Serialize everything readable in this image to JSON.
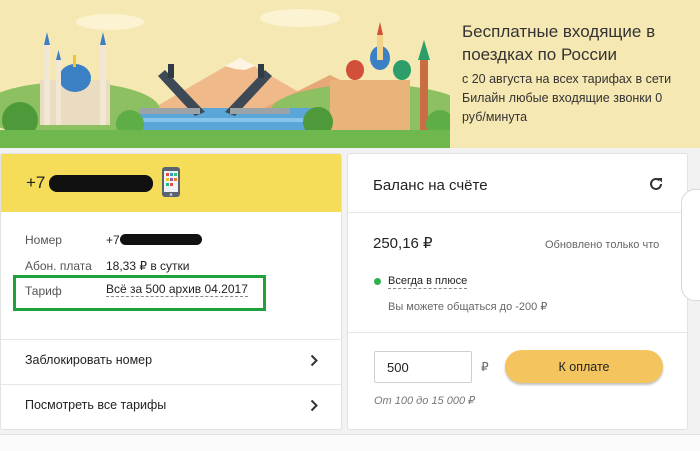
{
  "banner": {
    "title": "Бесплатные входящие в поездках по России",
    "text": "с 20 августа на всех тарифах в сети Билайн любые входящие звонки 0 руб/минута"
  },
  "account": {
    "phone_prefix": "+7",
    "number_label": "Номер",
    "number_prefix": "+7",
    "fee_label": "Абон. плата",
    "fee_value": "18,33 ₽ в сутки",
    "tariff_label": "Тариф",
    "tariff_value": "Всё за 500 архив 04.2017",
    "block_link": "Заблокировать номер",
    "all_tariffs_link": "Посмотреть все тарифы"
  },
  "balance": {
    "title": "Баланс на счёте",
    "amount": "250,16 ₽",
    "updated": "Обновлено только что",
    "plus_link": "Всегда в плюсе",
    "plus_note": "Вы можете общаться до -200 ₽",
    "pay_value": "500",
    "currency": "₽",
    "pay_button": "К оплате",
    "pay_hint": "От 100 до 15 000 ₽"
  },
  "colors": {
    "header_yellow": "#f5dd5a",
    "button_yellow": "#f4c55e",
    "highlight_green": "#1fa23b",
    "status_green": "#2bb24c"
  }
}
